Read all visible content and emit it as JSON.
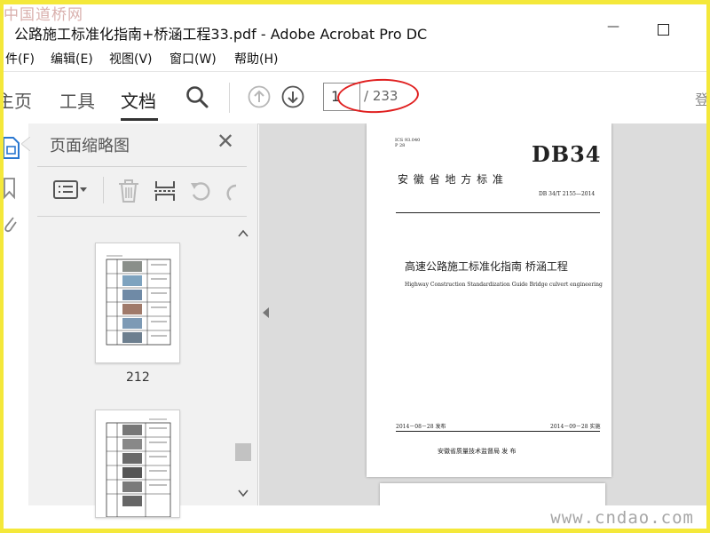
{
  "watermark": {
    "top": "中国道桥网",
    "bottom": "www.cndao.com"
  },
  "window": {
    "title": "公路施工标准化指南+桥涵工程33.pdf - Adobe Acrobat Pro DC",
    "minimize": "—"
  },
  "menu": [
    "件(F)",
    "编辑(E)",
    "视图(V)",
    "窗口(W)",
    "帮助(H)"
  ],
  "toolbar": {
    "tabs": [
      {
        "label": "主页"
      },
      {
        "label": "工具"
      },
      {
        "label": "文档"
      }
    ],
    "page_current": "1",
    "page_total": "/ 233",
    "right_glyph": "登"
  },
  "thumbnails_panel": {
    "title": "页面缩略图",
    "close_glyph": "✕",
    "pages": [
      {
        "label": "212"
      },
      {
        "label": ""
      }
    ]
  },
  "document_page": {
    "ics_line1": "ICS 93.040",
    "ics_line2": "P 28",
    "code": "DB34",
    "province": "安 徽 省 地 方 标 准",
    "standard_no": "DB 34/T 2155—2014",
    "title_cn": "高速公路施工标准化指南   桥涵工程",
    "title_en": "Highway Construction Standardization Guide   Bridge culvert engineering",
    "release_date": "2014－08－28 发布",
    "implement_date": "2014－09－28 实施",
    "issuer": "安徽省质量技术监督局   发 布"
  },
  "colors": {
    "frame": "#f4e83a",
    "annotation_ring": "#e02020",
    "panel_bg": "#f1f1f1",
    "doc_bg": "#dcdcdc"
  }
}
